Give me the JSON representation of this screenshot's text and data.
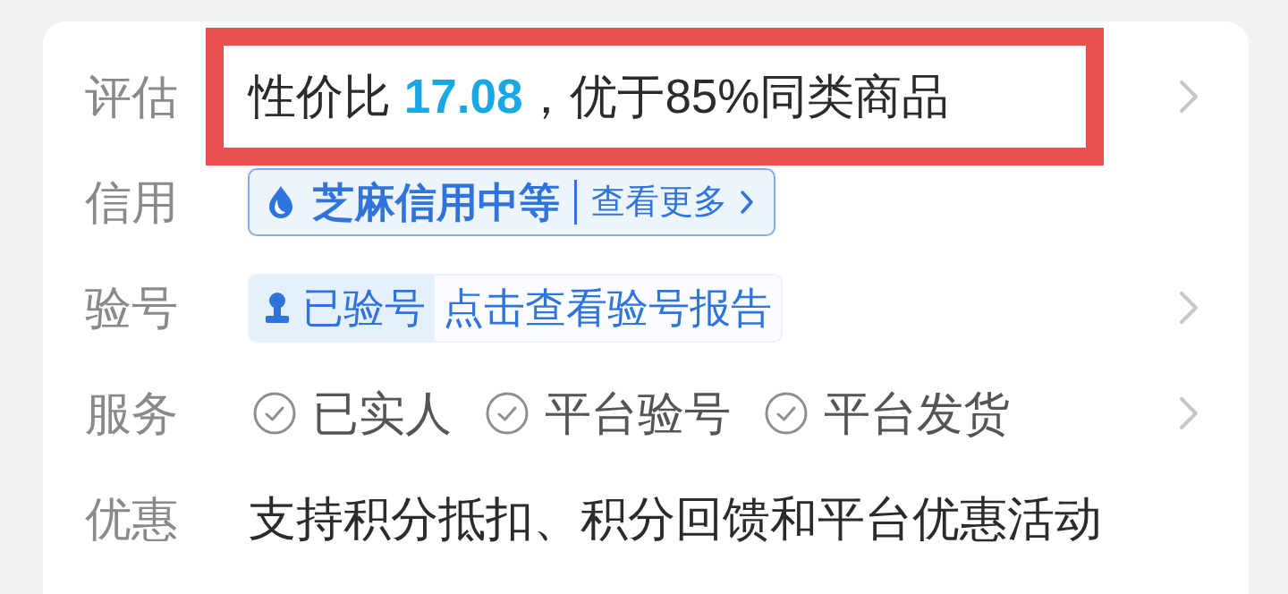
{
  "rows": [
    {
      "kind": "text",
      "label": "评估",
      "value": "性价比 **17.08**，优于85%同类商品",
      "highlighted": true,
      "arrow": true
    },
    {
      "kind": "credit",
      "label": "信用",
      "badge": {
        "title": "芝麻信用中等",
        "link": "查看更多"
      },
      "arrow": false
    },
    {
      "kind": "verify",
      "label": "验号",
      "badge": {
        "status": "已验号",
        "link": "点击查看验号报告"
      },
      "arrow": true
    },
    {
      "kind": "services",
      "label": "服务",
      "services": [
        "已实人",
        "平台验号",
        "平台发货"
      ],
      "arrow": true
    },
    {
      "kind": "text",
      "label": "优惠",
      "value": "支持积分抵扣、积分回馈和平台优惠活动",
      "highlighted": false,
      "arrow": false
    }
  ]
}
